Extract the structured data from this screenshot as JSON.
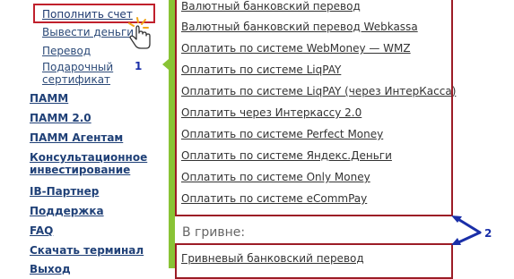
{
  "sidebar": {
    "sub_items": [
      {
        "label": "Пополнить счет"
      },
      {
        "label": "Вывести деньги"
      },
      {
        "label": "Перевод"
      },
      {
        "label": "Подарочный сертификат"
      }
    ],
    "gift_line1": "Подарочный",
    "gift_line2": "сертификат",
    "main_items": [
      {
        "label": "ПАММ"
      },
      {
        "label": "ПАММ 2.0"
      },
      {
        "label": "ПАММ Агентам"
      },
      {
        "label": "Консультационное инвестирование"
      },
      {
        "label": "IB-Партнер"
      },
      {
        "label": "Поддержка"
      },
      {
        "label": "FAQ"
      },
      {
        "label": "Скачать терминал"
      },
      {
        "label": "Выход"
      }
    ],
    "consult_line1": "Консультационное",
    "consult_line2": "инвестирование"
  },
  "annotations": {
    "marker1": "1",
    "marker2": "2",
    "accent": "#c0202c",
    "marker_color": "#1a2fa8"
  },
  "payments": {
    "links": [
      {
        "label": "Валютный банковский перевод"
      },
      {
        "label": "Валютный банковский перевод Webkassa"
      },
      {
        "label": "Оплатить по системе WebMoney — WMZ"
      },
      {
        "label": "Оплатить по системе LiqPAY"
      },
      {
        "label": "Оплатить по системе LiqPAY (через ИнтерКасса)"
      },
      {
        "label": "Оплатить через Интеркассу 2.0"
      },
      {
        "label": "Оплатить по системе Perfect Money"
      },
      {
        "label": "Оплатить по системе Яндекс.Деньги"
      },
      {
        "label": "Оплатить по системе Only Money"
      },
      {
        "label": "Оплатить по системе eCommPay"
      }
    ],
    "hryvnia_section": {
      "title": "В гривне:",
      "links": [
        {
          "label": "Гривневый банковский перевод"
        }
      ]
    }
  },
  "icons": {
    "cursor": "hand-pointer-icon",
    "arrows": "double-arrow-icon"
  },
  "colors": {
    "green_rail": "#89c335",
    "box_border": "#9c1c26",
    "nav_link": "#1f4077"
  }
}
